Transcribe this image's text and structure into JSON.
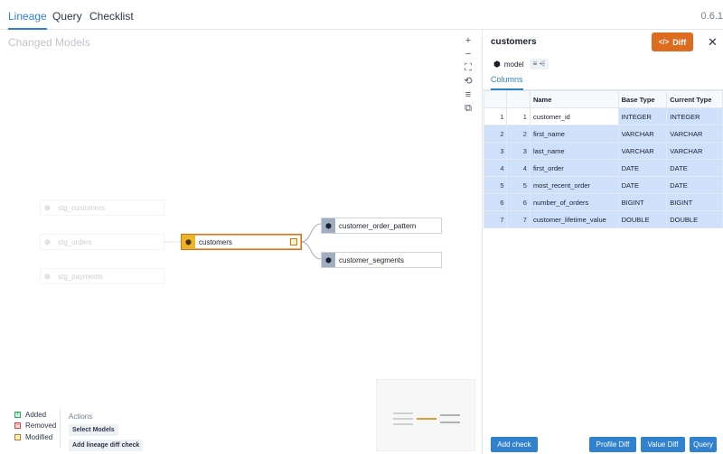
{
  "tabs": {
    "lineage": "Lineage",
    "query": "Query",
    "checklist": "Checklist"
  },
  "version": "0.6.1",
  "canvas": {
    "title": "Changed Models",
    "controls": [
      "+",
      "−",
      "⛶",
      "⟲",
      "≡",
      "⧉"
    ],
    "nodes": {
      "stg_customers": "stg_customers",
      "stg_orders": "stg_orders",
      "stg_payments": "stg_payments",
      "customers": "customers",
      "customer_order_pattern": "customer_order_pattern",
      "customer_segments": "customer_segments"
    },
    "legend": {
      "added": "Added",
      "removed": "Removed",
      "modified": "Modified"
    },
    "actions": {
      "title": "Actions",
      "select_models": "Select Models",
      "add_lineage_diff_check": "Add lineage diff check"
    }
  },
  "panel": {
    "title": "customers",
    "diff_button": "Diff",
    "model_label": "model",
    "columns_tab": "Columns",
    "table": {
      "headers": [
        "",
        "",
        "Name",
        "Base Type",
        "Current Type"
      ],
      "rows": [
        {
          "i1": "1",
          "i2": "1",
          "name": "customer_id",
          "base": "INTEGER",
          "current": "INTEGER"
        },
        {
          "i1": "2",
          "i2": "2",
          "name": "first_name",
          "base": "VARCHAR",
          "current": "VARCHAR"
        },
        {
          "i1": "3",
          "i2": "3",
          "name": "last_name",
          "base": "VARCHAR",
          "current": "VARCHAR"
        },
        {
          "i1": "4",
          "i2": "4",
          "name": "first_order",
          "base": "DATE",
          "current": "DATE"
        },
        {
          "i1": "5",
          "i2": "5",
          "name": "most_recent_order",
          "base": "DATE",
          "current": "DATE"
        },
        {
          "i1": "6",
          "i2": "6",
          "name": "number_of_orders",
          "base": "BIGINT",
          "current": "BIGINT"
        },
        {
          "i1": "7",
          "i2": "7",
          "name": "customer_lifetime_value",
          "base": "DOUBLE",
          "current": "DOUBLE"
        }
      ]
    },
    "footer": {
      "add_check": "Add check",
      "profile_diff": "Profile Diff",
      "value_diff": "Value Diff",
      "query": "Query"
    }
  },
  "colors": {
    "accent": "#3182ce",
    "diff": "#dd6b20",
    "modified": "#ecb429",
    "selection": "#cfe0fb"
  }
}
